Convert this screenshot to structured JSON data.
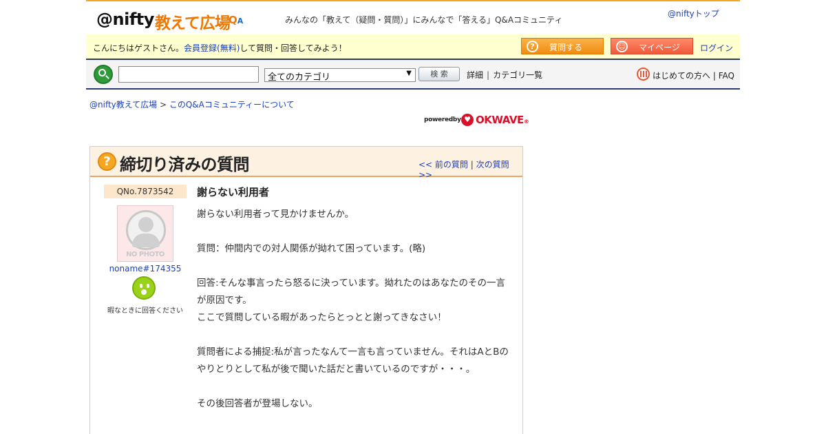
{
  "header": {
    "logo_nifty": "@nifty",
    "logo_oshiete": "教えて広場",
    "logo_q": "Q",
    "logo_a": "A",
    "tagline": "みんなの「教えて（疑問・質問）」にみんなで「答える」Q&Aコミュニティ",
    "nifty_top": "@niftyトップ"
  },
  "greeting": {
    "prefix": "こんにちはゲストさん。",
    "register_link": "会員登録(無料)",
    "suffix": "して質問・回答してみよう！",
    "ask_button": "質問する",
    "mypage_button": "マイページ",
    "login": "ログイン"
  },
  "search": {
    "input_value": "",
    "category_selected": "全てのカテゴリ",
    "search_button": "検 索",
    "detail_link": "詳細",
    "category_list_link": "カテゴリ一覧",
    "first_time_link": "はじめての方へ",
    "faq_link": "FAQ"
  },
  "breadcrumb": {
    "home": "@nifty教えて広場",
    "separator": " > ",
    "current": "このQ&Aコミュニティーについて"
  },
  "powered": {
    "text": "poweredby",
    "brand": "OKWAVE",
    "mark": "®"
  },
  "question": {
    "heading": "締切り済みの質問",
    "prev": "<< 前の質問",
    "pager_sep": " | ",
    "next": "次の質問 >>",
    "qno": "QNo.7873542",
    "avatar_label": "NO PHOTO",
    "username": "noname#174355",
    "mood": "暇なときに回答ください",
    "title": "謝らない利用者",
    "body": [
      "謝らない利用者って見かけませんか。",
      "",
      "質問：仲間内での対人関係が拗れて困っています。(略)",
      "",
      "回答:そんな事言ったら怒るに決っています。拗れたのはあなたのその一言が原因です。",
      "ここで質問している暇があったらとっとと謝ってきなさい！",
      "",
      "質問者による捕捉:私が言ったなんて一言も言っていません。それはAとBのやりとりとして私が後で聞いた話だと書いているのですが・・・。",
      "",
      "その後回答者が登場しない。"
    ]
  },
  "colors": {
    "accent_orange": "#f5a623",
    "link_blue": "#1a3fbb",
    "greeting_bg": "#ffffcf",
    "nav_border": "#2a3a6a",
    "okwave_red": "#d8102a",
    "mood_green": "#9ad21a"
  }
}
